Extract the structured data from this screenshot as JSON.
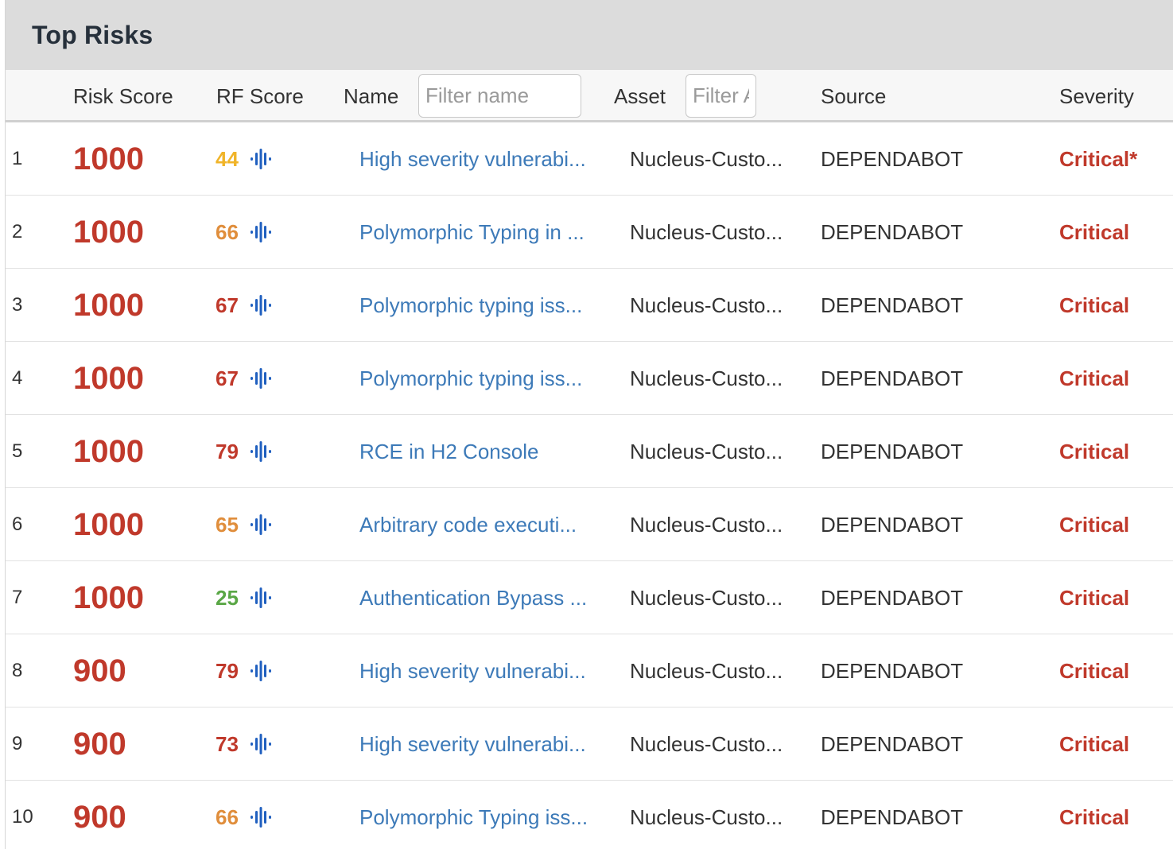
{
  "panel": {
    "title": "Top Risks"
  },
  "columns": {
    "risk_score": "Risk Score",
    "rf_score": "RF Score",
    "name": "Name",
    "name_filter_placeholder": "Filter name",
    "asset": "Asset",
    "asset_filter_placeholder": "Filter Asset",
    "source": "Source",
    "severity": "Severity"
  },
  "colors": {
    "critical": "#c0392b",
    "link": "#3d7ab8",
    "rf_yellow": "#f0b429",
    "rf_orange": "#e08e3c",
    "rf_red": "#c0392b",
    "rf_green": "#5aa746",
    "icon_blue": "#1f5fbf"
  },
  "rows": [
    {
      "index": "1",
      "risk_score": "1000",
      "rf_score": "44",
      "rf_level": "yellow",
      "rf_icon": "recorded-future-icon",
      "name": "High severity vulnerabi...",
      "asset": "Nucleus-Custo...",
      "source": "DEPENDABOT",
      "severity": "Critical*"
    },
    {
      "index": "2",
      "risk_score": "1000",
      "rf_score": "66",
      "rf_level": "orange",
      "rf_icon": "recorded-future-icon",
      "name": "Polymorphic Typing in ...",
      "asset": "Nucleus-Custo...",
      "source": "DEPENDABOT",
      "severity": "Critical"
    },
    {
      "index": "3",
      "risk_score": "1000",
      "rf_score": "67",
      "rf_level": "red",
      "rf_icon": "recorded-future-icon",
      "name": "Polymorphic typing iss...",
      "asset": "Nucleus-Custo...",
      "source": "DEPENDABOT",
      "severity": "Critical"
    },
    {
      "index": "4",
      "risk_score": "1000",
      "rf_score": "67",
      "rf_level": "red",
      "rf_icon": "recorded-future-icon",
      "name": "Polymorphic typing iss...",
      "asset": "Nucleus-Custo...",
      "source": "DEPENDABOT",
      "severity": "Critical"
    },
    {
      "index": "5",
      "risk_score": "1000",
      "rf_score": "79",
      "rf_level": "red",
      "rf_icon": "recorded-future-icon",
      "name": "RCE in H2 Console",
      "asset": "Nucleus-Custo...",
      "source": "DEPENDABOT",
      "severity": "Critical"
    },
    {
      "index": "6",
      "risk_score": "1000",
      "rf_score": "65",
      "rf_level": "orange",
      "rf_icon": "recorded-future-icon",
      "name": "Arbitrary code executi...",
      "asset": "Nucleus-Custo...",
      "source": "DEPENDABOT",
      "severity": "Critical"
    },
    {
      "index": "7",
      "risk_score": "1000",
      "rf_score": "25",
      "rf_level": "green",
      "rf_icon": "recorded-future-icon",
      "name": "Authentication Bypass ...",
      "asset": "Nucleus-Custo...",
      "source": "DEPENDABOT",
      "severity": "Critical"
    },
    {
      "index": "8",
      "risk_score": "900",
      "rf_score": "79",
      "rf_level": "red",
      "rf_icon": "recorded-future-icon",
      "name": "High severity vulnerabi...",
      "asset": "Nucleus-Custo...",
      "source": "DEPENDABOT",
      "severity": "Critical"
    },
    {
      "index": "9",
      "risk_score": "900",
      "rf_score": "73",
      "rf_level": "red",
      "rf_icon": "recorded-future-icon",
      "name": "High severity vulnerabi...",
      "asset": "Nucleus-Custo...",
      "source": "DEPENDABOT",
      "severity": "Critical"
    },
    {
      "index": "10",
      "risk_score": "900",
      "rf_score": "66",
      "rf_level": "orange",
      "rf_icon": "recorded-future-icon",
      "name": "Polymorphic Typing iss...",
      "asset": "Nucleus-Custo...",
      "source": "DEPENDABOT",
      "severity": "Critical"
    }
  ]
}
